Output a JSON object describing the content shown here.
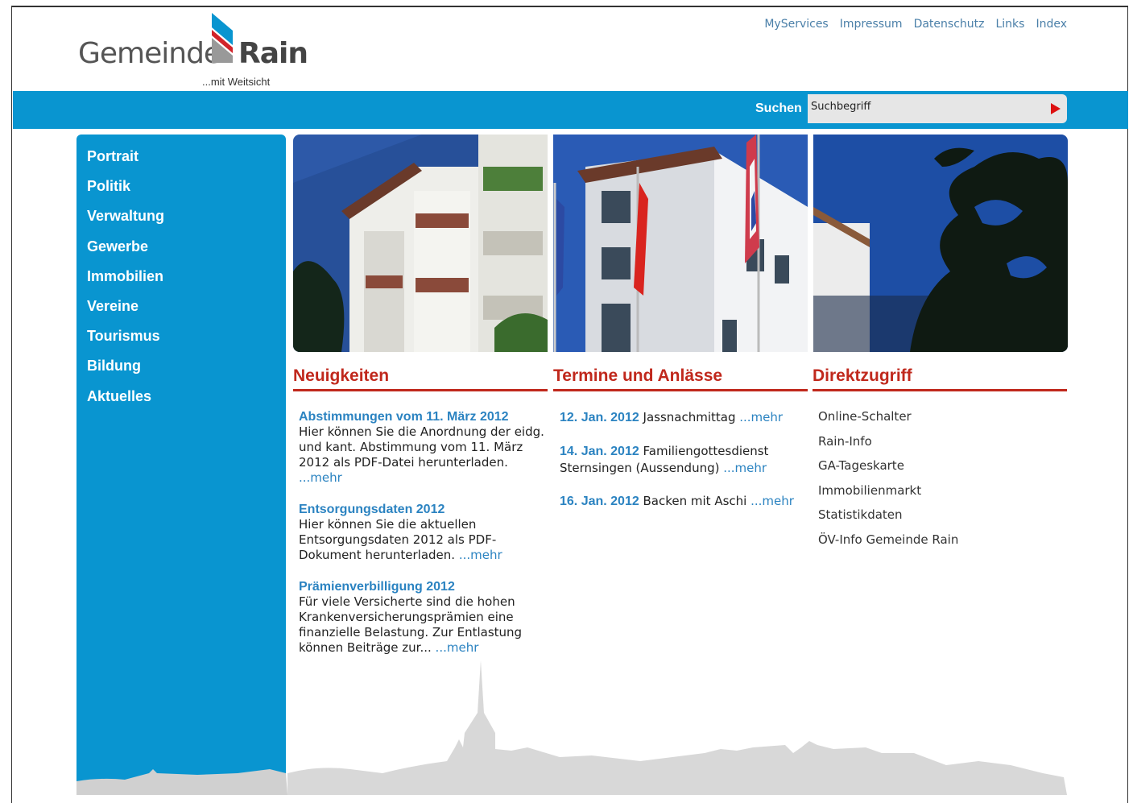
{
  "logo": {
    "part1": "Gemeinde",
    "part2": "Rain",
    "tagline": "...mit Weitsicht"
  },
  "top_links": [
    "MyServices",
    "Impressum",
    "Datenschutz",
    "Links",
    "Index"
  ],
  "search": {
    "label": "Suchen",
    "value": "Suchbegriff"
  },
  "nav": [
    "Portrait",
    "Politik",
    "Verwaltung",
    "Gewerbe",
    "Immobilien",
    "Vereine",
    "Tourismus",
    "Bildung",
    "Aktuelles"
  ],
  "columns": {
    "news": "Neuigkeiten",
    "events": "Termine und Anlässe",
    "direct": "Direktzugriff"
  },
  "more_label": "...mehr",
  "news": [
    {
      "title": "Abstimmungen vom 11. März 2012",
      "body": "Hier können Sie die Anordnung der eidg. und kant. Abstimmung vom 11. März 2012 als PDF-Datei herunterladen. "
    },
    {
      "title": "Entsorgungsdaten 2012",
      "body": "Hier können Sie die aktuellen Entsorgungsdaten 2012 als PDF-Dokument herunterladen. "
    },
    {
      "title": "Prämienverbilligung 2012",
      "body": "Für viele Versicherte sind die hohen Krankenversicherungsprämien eine finanzielle Belastung. Zur Entlastung können Beiträge zur... "
    }
  ],
  "events": [
    {
      "date": "12. Jan. 2012",
      "text": " Jassnachmittag "
    },
    {
      "date": "14. Jan. 2012",
      "text": " Familiengottesdienst Sternsingen (Aussendung) "
    },
    {
      "date": "16. Jan. 2012",
      "text": " Backen mit Aschi "
    }
  ],
  "direct_links": [
    "Online-Schalter",
    "Rain-Info",
    "GA-Tageskarte",
    "Immobilienmarkt",
    "Statistikdaten",
    "ÖV-Info Gemeinde Rain"
  ],
  "colors": {
    "brand_blue": "#0995d0",
    "accent_red": "#c0281c",
    "link_blue": "#2b83c1"
  }
}
